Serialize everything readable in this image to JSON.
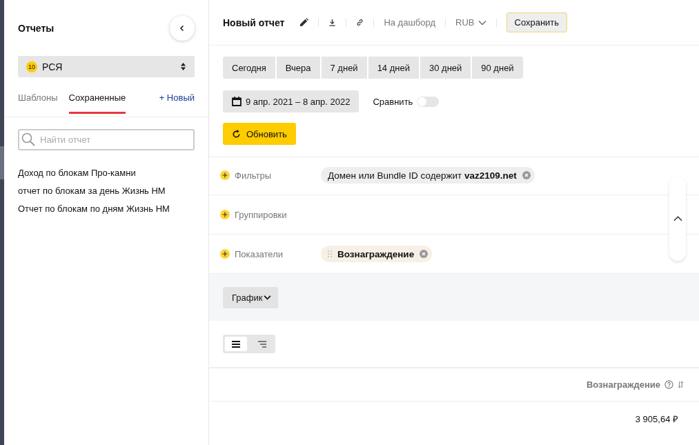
{
  "sidebar": {
    "title": "Отчеты",
    "source": {
      "badge": "10",
      "label": "РСЯ"
    },
    "tabs": [
      {
        "label": "Шаблоны",
        "selected": false
      },
      {
        "label": "Сохраненные",
        "selected": true
      }
    ],
    "new_link": "+ Новый",
    "search": {
      "placeholder": "Найти отчет"
    },
    "reports": [
      "Доход по блокам Про-камни",
      "отчет по блокам за день Жизнь НМ",
      "Отчет по блокам по дням Жизнь НМ"
    ]
  },
  "toolbar": {
    "title": "Новый отчет",
    "dashboard": "На дашборд",
    "currency": "RUB",
    "save": "Сохранить"
  },
  "periods": [
    {
      "label": "Сегодня",
      "selected": false
    },
    {
      "label": "Вчера",
      "selected": false
    },
    {
      "label": "7 дней",
      "selected": false
    },
    {
      "label": "14 дней",
      "selected": false
    },
    {
      "label": "30 дней",
      "selected": false
    },
    {
      "label": "90 дней",
      "selected": false
    }
  ],
  "date_range": "9 апр. 2021 – 8 апр. 2022",
  "compare": {
    "label": "Сравнить",
    "on": false
  },
  "refresh": "Обновить",
  "params": [
    {
      "label": "Фильтры",
      "chips": [
        {
          "kind": "filter",
          "text": "Домен или Bundle ID содержит **vaz2109.net**"
        }
      ]
    },
    {
      "label": "Группировки"
    },
    {
      "label": "Показатели",
      "chips": [
        {
          "kind": "metric",
          "text": "Вознаграждение"
        }
      ]
    }
  ],
  "chart_button": "График",
  "views": [
    {
      "kind": "flat",
      "selected": true
    },
    {
      "kind": "tree",
      "selected": false
    }
  ],
  "table": {
    "columns": [
      "Вознаграждение"
    ],
    "rows": [
      [
        "3 905,64 ₽"
      ]
    ]
  }
}
